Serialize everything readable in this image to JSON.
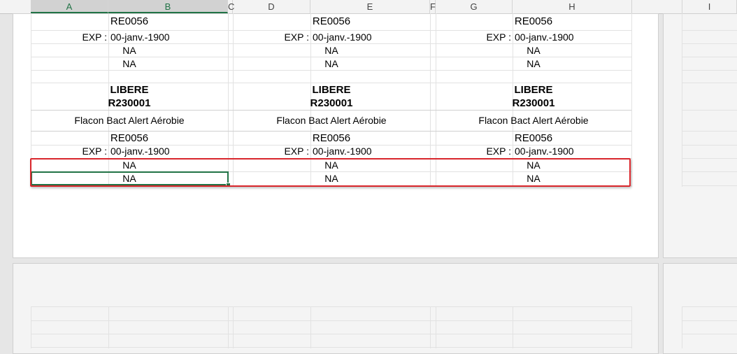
{
  "columns": [
    {
      "label": "A",
      "selected": true
    },
    {
      "label": "B",
      "selected": true
    },
    {
      "label": "C",
      "selected": false
    },
    {
      "label": "D",
      "selected": false
    },
    {
      "label": "E",
      "selected": false
    },
    {
      "label": "F",
      "selected": false
    },
    {
      "label": "G",
      "selected": false
    },
    {
      "label": "H",
      "selected": false
    },
    {
      "label": "I",
      "selected": false
    }
  ],
  "blocks": [
    {
      "top_ref": "RE0056",
      "top_exp_label": "EXP :",
      "top_exp_value": "00-janv.-1900",
      "top_na1": "NA",
      "top_na2": "NA",
      "status": "LIBERE",
      "code": "R230001",
      "product": "Flacon Bact Alert Aérobie",
      "ref": "RE0056",
      "exp_label": "EXP :",
      "exp_value": "00-janv.-1900",
      "na1": "NA",
      "na2": "NA"
    },
    {
      "top_ref": "RE0056",
      "top_exp_label": "EXP :",
      "top_exp_value": "00-janv.-1900",
      "top_na1": "NA",
      "top_na2": "NA",
      "status": "LIBERE",
      "code": "R230001",
      "product": "Flacon Bact Alert Aérobie",
      "ref": "RE0056",
      "exp_label": "EXP :",
      "exp_value": "00-janv.-1900",
      "na1": "NA",
      "na2": "NA"
    },
    {
      "top_ref": "RE0056",
      "top_exp_label": "EXP :",
      "top_exp_value": "00-janv.-1900",
      "top_na1": "NA",
      "top_na2": "NA",
      "status": "LIBERE",
      "code": "R230001",
      "product": "Flacon Bact Alert Aérobie",
      "ref": "RE0056",
      "exp_label": "EXP :",
      "exp_value": "00-janv.-1900",
      "na1": "NA",
      "na2": "NA"
    }
  ],
  "colors": {
    "selection": "#217346",
    "highlight": "#d9262c"
  }
}
